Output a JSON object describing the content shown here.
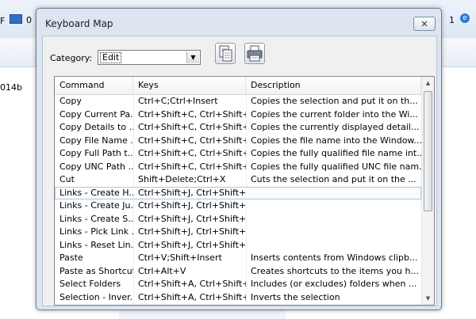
{
  "background": {
    "left_label": "014b",
    "f_label": "F",
    "zero_label": "0",
    "right_num": "1",
    "right_icon": "e"
  },
  "dialog": {
    "title": "Keyboard Map",
    "close_label": "✕",
    "category_label": "Category:",
    "category_value": "Edit",
    "columns": [
      "Command",
      "Keys",
      "Description"
    ],
    "rows": [
      {
        "command": "Copy",
        "keys": "Ctrl+C;Ctrl+Insert",
        "description": "Copies the selection and put it on th..."
      },
      {
        "command": "Copy Current Pa...",
        "keys": "Ctrl+Shift+C, Ctrl+Shift+O",
        "description": "Copies the current folder into the Wi..."
      },
      {
        "command": "Copy Details to ...",
        "keys": "Ctrl+Shift+C, Ctrl+Shift+D",
        "description": "Copies the currently displayed detail..."
      },
      {
        "command": "Copy File Name ...",
        "keys": "Ctrl+Shift+C, Ctrl+Shift+N",
        "description": "Copies the file name into the Window..."
      },
      {
        "command": "Copy Full Path t...",
        "keys": "Ctrl+Shift+C, Ctrl+Shift+P",
        "description": "Copies the fully qualified file name int..."
      },
      {
        "command": "Copy UNC Path ...",
        "keys": "Ctrl+Shift+C, Ctrl+Shift+U",
        "description": "Copies the fully qualified UNC file nam..."
      },
      {
        "command": "Cut",
        "keys": "Shift+Delete;Ctrl+X",
        "description": "Cuts the selection and put it on the ..."
      },
      {
        "command": "Links - Create H...",
        "keys": "Ctrl+Shift+J, Ctrl+Shift+H",
        "description": ""
      },
      {
        "command": "Links - Create Ju...",
        "keys": "Ctrl+Shift+J, Ctrl+Shift+A",
        "description": ""
      },
      {
        "command": "Links - Create S...",
        "keys": "Ctrl+Shift+J, Ctrl+Shift+S",
        "description": ""
      },
      {
        "command": "Links - Pick Link ...",
        "keys": "Ctrl+Shift+J, Ctrl+Shift+P",
        "description": ""
      },
      {
        "command": "Links - Reset Lin...",
        "keys": "Ctrl+Shift+J, Ctrl+Shift+R",
        "description": ""
      },
      {
        "command": "Paste",
        "keys": "Ctrl+V;Shift+Insert",
        "description": "Inserts contents from Windows clipb..."
      },
      {
        "command": "Paste as Shortcut",
        "keys": "Ctrl+Alt+V",
        "description": "Creates shortcuts to the items you h..."
      },
      {
        "command": "Select Folders",
        "keys": "Ctrl+Shift+A, Ctrl+Shift+O",
        "description": "Includes (or excludes) folders when ..."
      },
      {
        "command": "Selection - Inver...",
        "keys": "Ctrl+Shift+A, Ctrl+Shift+U",
        "description": "Inverts the selection"
      }
    ],
    "selected_row": 7
  },
  "icons": {
    "copy": "copy-icon",
    "print": "printer-icon",
    "monitor": "monitor-icon",
    "ie": "ie-icon"
  },
  "colors": {
    "dialog_frame": "#dce5f0",
    "selection_border": "#a9c6e8"
  }
}
